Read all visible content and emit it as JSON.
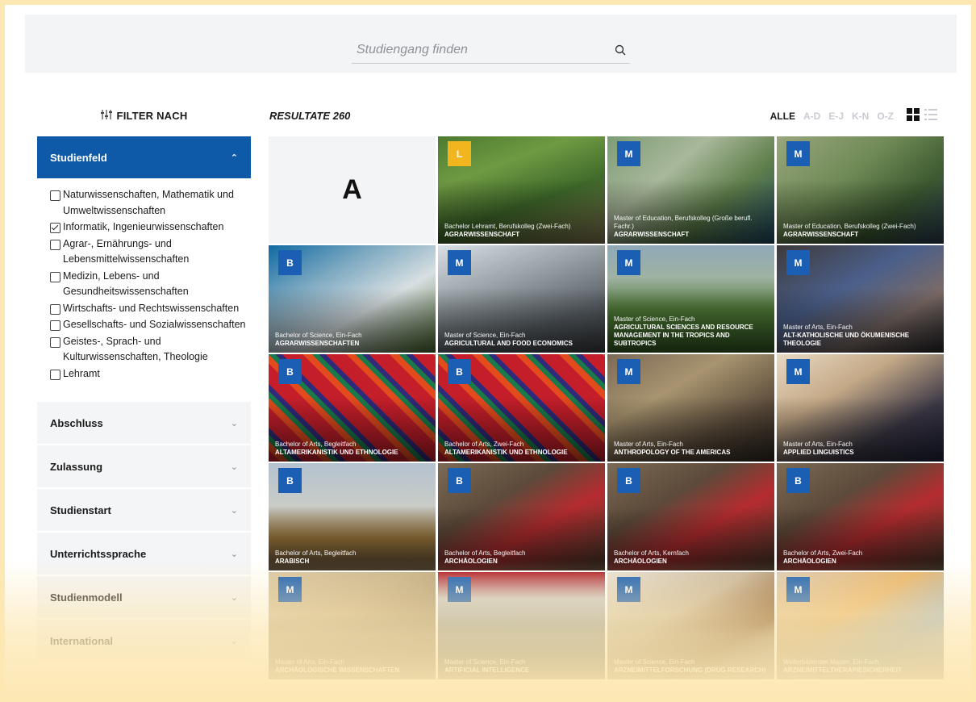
{
  "search": {
    "placeholder": "Studiengang finden"
  },
  "filter": {
    "title": "FILTER NACH"
  },
  "sidebar": {
    "studienfeld": {
      "label": "Studienfeld",
      "options": [
        {
          "label": "Naturwissenschaften, Mathematik und Umweltwissenschaften",
          "checked": false
        },
        {
          "label": "Informatik, Ingenieurwissenschaften",
          "checked": true
        },
        {
          "label": "Agrar-, Ernährungs- und Lebensmittelwissenschaften",
          "checked": false
        },
        {
          "label": "Medizin, Lebens- und Gesundheitswissenschaften",
          "checked": false
        },
        {
          "label": "Wirtschafts- und Rechtswissenschaften",
          "checked": false
        },
        {
          "label": "Gesellschafts- und Sozialwissenschaften",
          "checked": false
        },
        {
          "label": "Geistes-, Sprach- und Kulturwissenschaften, Theologie",
          "checked": false
        },
        {
          "label": "Lehramt",
          "checked": false
        }
      ]
    },
    "groups": [
      {
        "label": "Abschluss"
      },
      {
        "label": "Zulassung"
      },
      {
        "label": "Studienstart"
      },
      {
        "label": "Unterrichtssprache"
      },
      {
        "label": "Studienmodell"
      },
      {
        "label": "International"
      }
    ]
  },
  "results": {
    "title": "RESULTATE 260",
    "letter_filters": [
      "ALLE",
      "A-D",
      "E-J",
      "K-N",
      "O-Z"
    ],
    "active_letter": "ALLE",
    "section_letter": "A",
    "cards": [
      {
        "badge": "L",
        "subtitle": "Bachelor Lehramt, Berufskolleg (Zwei-Fach)",
        "title": "AGRARWISSENSCHAFT",
        "bg": "bg1"
      },
      {
        "badge": "M",
        "subtitle": "Master of Education, Berufskolleg (Große berufl. Fachr.)",
        "title": "AGRARWISSENSCHAFT",
        "bg": "bg2"
      },
      {
        "badge": "M",
        "subtitle": "Master of Education, Berufskolleg (Zwei-Fach)",
        "title": "AGRARWISSENSCHAFT",
        "bg": "bg3"
      },
      {
        "badge": "B",
        "subtitle": "Bachelor of Science, Ein-Fach",
        "title": "AGRARWISSENSCHAFTEN",
        "bg": "bg4"
      },
      {
        "badge": "M",
        "subtitle": "Master of Science, Ein-Fach",
        "title": "AGRICULTURAL AND FOOD ECONOMICS",
        "bg": "bg5"
      },
      {
        "badge": "M",
        "subtitle": "Master of Science, Ein-Fach",
        "title": "AGRICULTURAL SCIENCES AND RESOURCE MANAGEMENT IN THE TROPICS AND SUBTROPICS",
        "bg": "bg6"
      },
      {
        "badge": "M",
        "subtitle": "Master of Arts, Ein-Fach",
        "title": "ALT-KATHOLISCHE UND ÖKUMENISCHE THEOLOGIE",
        "bg": "bg7"
      },
      {
        "badge": "B",
        "subtitle": "Bachelor of Arts, Begleitfach",
        "title": "ALTAMERIKANISTIK UND ETHNOLOGIE",
        "bg": "bg8"
      },
      {
        "badge": "B",
        "subtitle": "Bachelor of Arts, Zwei-Fach",
        "title": "ALTAMERIKANISTIK UND ETHNOLOGIE",
        "bg": "bg8"
      },
      {
        "badge": "M",
        "subtitle": "Master of Arts, Ein-Fach",
        "title": "ANTHROPOLOGY OF THE AMERICAS",
        "bg": "bg9"
      },
      {
        "badge": "M",
        "subtitle": "Master of Arts, Ein-Fach",
        "title": "APPLIED LINGUISTICS",
        "bg": "bg10"
      },
      {
        "badge": "B",
        "subtitle": "Bachelor of Arts, Begleitfach",
        "title": "ARABISCH",
        "bg": "bg11"
      },
      {
        "badge": "B",
        "subtitle": "Bachelor of Arts, Begleitfach",
        "title": "ARCHÄOLOGIEN",
        "bg": "bg12"
      },
      {
        "badge": "B",
        "subtitle": "Bachelor of Arts, Kernfach",
        "title": "ARCHÄOLOGIEN",
        "bg": "bg12"
      },
      {
        "badge": "B",
        "subtitle": "Bachelor of Arts, Zwei-Fach",
        "title": "ARCHÄOLOGIEN",
        "bg": "bg12"
      },
      {
        "badge": "M",
        "subtitle": "Master of Arts, Ein-Fach",
        "title": "ARCHÄOLOGISCHE WISSENSCHAFTEN",
        "bg": "bg13"
      },
      {
        "badge": "M",
        "subtitle": "Master of Science, Ein-Fach",
        "title": "ARTIFICIAL INTELLIGENCE",
        "bg": "bg14"
      },
      {
        "badge": "M",
        "subtitle": "Master of Science, Ein-Fach",
        "title": "ARZNEIMITTELFORSCHUNG (DRUG RESEARCH)",
        "bg": "bg15"
      },
      {
        "badge": "M",
        "subtitle": "Weiterbildender Master, Ein-Fach",
        "title": "ARZNEIMITTELTHERAPIESICHERHEIT",
        "bg": "bg16"
      }
    ]
  },
  "colors": {
    "brand_blue": "#0f5aa8",
    "badge_yellow": "#f2b51d",
    "backdrop": "#fde8b4"
  }
}
